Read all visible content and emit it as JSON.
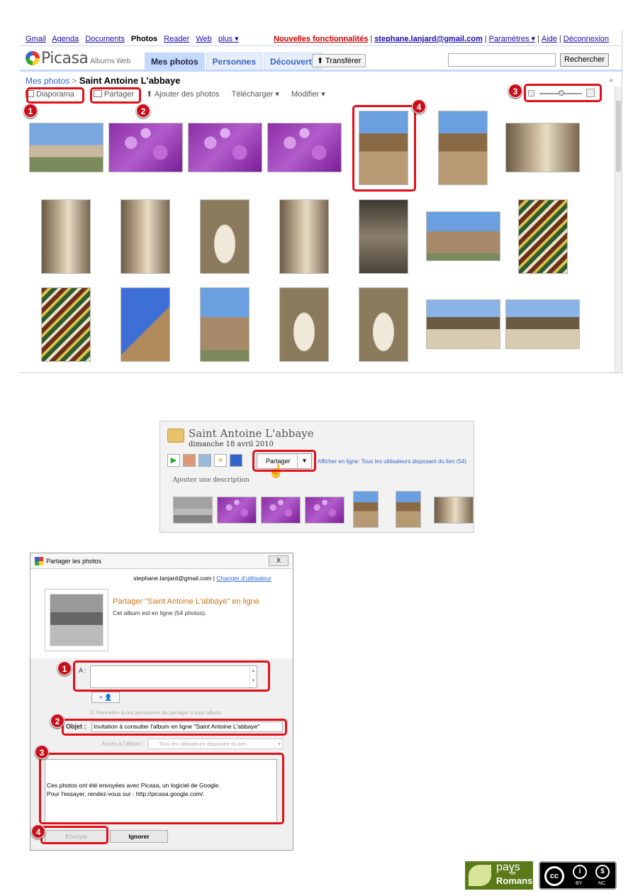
{
  "web": {
    "gbar_left": [
      "Gmail",
      "Agenda",
      "Documents",
      "Photos",
      "Reader",
      "Web",
      "plus ▾"
    ],
    "new_features": "Nouvelles fonctionnalités",
    "email": "stephane.lanjard@gmail.com",
    "settings": "Paramètres ▾",
    "help": "Aide",
    "logout": "Déconnexion",
    "logo": "Picasa",
    "logo_sub": "Albums Web",
    "tabs": [
      "Mes photos",
      "Personnes",
      "Découverte"
    ],
    "upload": "Transférer",
    "search_button": "Rechercher",
    "breadcrumb_link": "Mes photos",
    "breadcrumb_sep": ">",
    "album_title": "Saint Antoine L'abbaye",
    "toolbar": {
      "slideshow": "Diaporama",
      "share": "Partager",
      "add_photos": "Ajouter des photos",
      "download": "Télécharger",
      "edit": "Modifier"
    },
    "callouts": [
      "1",
      "2",
      "3",
      "4"
    ]
  },
  "desktop": {
    "album_title": "Saint Antoine L'abbaye",
    "date": "dimanche 18 avril 2010",
    "share": "Partager",
    "online": "Afficher en ligne: Tous les utilisateurs disposant du lien (54)",
    "add_description": "Ajouter une description"
  },
  "dialog": {
    "title": "Partager les photos",
    "close": "X",
    "account": "stephane.lanjard@gmail.com",
    "change_user": "Changer d'utilisateur",
    "share_heading": "Partager \"Saint Antoine L'abbaye\" en ligne",
    "share_sub": "Cet album est en ligne (54 photos).",
    "to_label": "A :",
    "add_contact": "+ ",
    "permit": "Permettre à ces personnes de partager à mon album",
    "subject_label": "Objet :",
    "subject_value": "Invitation à consulter l'album en ligne \"Saint Antoine L'abbaye\"",
    "access_label": "Accès à l'album :",
    "access_value": "Tous les utilisateurs disposant du lien",
    "message_line1": "Ces photos ont été envoyées avec Picasa, un logiciel de Google.",
    "message_line2": "Pour l'essayer, rendez-vous sur : http://picasa.google.com/.",
    "send": "Envoyer",
    "ignore": "Ignorer",
    "callouts": [
      "1",
      "2",
      "3",
      "4"
    ]
  },
  "footer": {
    "pays": "pays",
    "de": "de",
    "romans": "Romans",
    "cc": "cc",
    "by": "BY",
    "nc": "NC"
  }
}
